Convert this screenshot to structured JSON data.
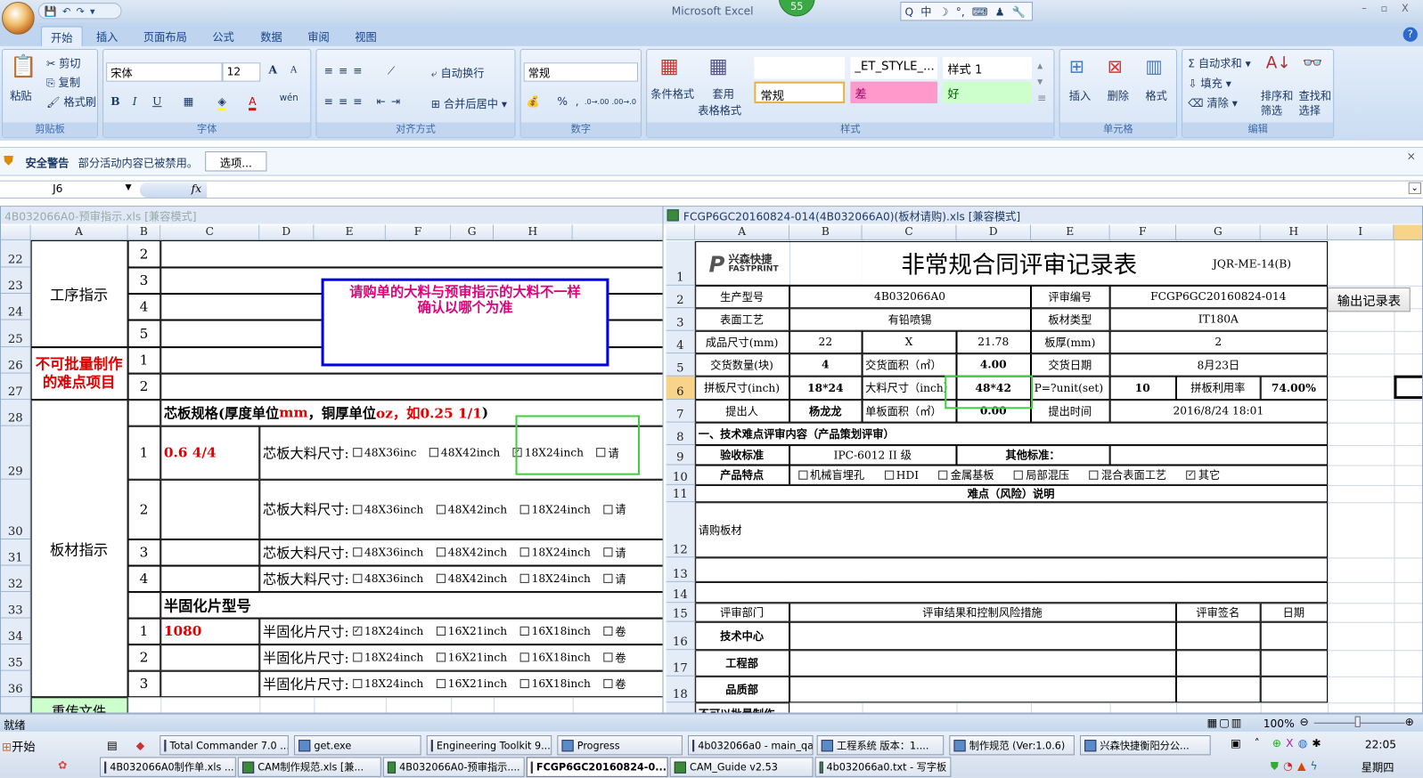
{
  "app": {
    "title": "Microsoft Excel",
    "badge": "55",
    "qat_icons": [
      "save-icon",
      "undo-icon",
      "redo-icon",
      "customize-icon"
    ],
    "ime": [
      "Q",
      "中",
      "☽",
      "°,",
      "⌨",
      "♟",
      "🔧"
    ],
    "window_controls": "– ▫ X",
    "help": "?"
  },
  "tabs": [
    {
      "label": "开始",
      "active": true
    },
    {
      "label": "插入"
    },
    {
      "label": "页面布局"
    },
    {
      "label": "公式"
    },
    {
      "label": "数据"
    },
    {
      "label": "审阅"
    },
    {
      "label": "视图"
    }
  ],
  "ribbon": {
    "clipboard": {
      "label": "剪贴板",
      "paste": "粘贴",
      "cut": "剪切",
      "copy": "复制",
      "format_painter": "格式刷"
    },
    "font": {
      "label": "字体",
      "name": "宋体",
      "size": "12",
      "bold": "B",
      "italic": "I",
      "underline": "U",
      "grow": "A",
      "shrink": "A",
      "font_color": "A",
      "phonetic": "wén"
    },
    "alignment": {
      "label": "对齐方式",
      "wrap": "自动换行",
      "merge": "合并后居中"
    },
    "number": {
      "label": "数字",
      "format": "常规",
      "percent": "%",
      "comma": ",",
      "inc": ".0→.00",
      "dec": ".00→.0"
    },
    "styles": {
      "label": "样式",
      "conditional": "条件格式",
      "table_format_1": "套用",
      "table_format_2": "表格格式",
      "cells": [
        "",
        "_ET_STYLE_...",
        "样式 1",
        "常规",
        "差",
        "好"
      ],
      "colors": {
        "bad": "#ff99cc",
        "good": "#ccffcc"
      }
    },
    "cells": {
      "label": "单元格",
      "insert": "插入",
      "delete": "删除",
      "format": "格式"
    },
    "editing": {
      "label": "编辑",
      "autosum": "自动求和",
      "fill": "填充",
      "clear": "清除",
      "sort_1": "排序和",
      "sort_2": "筛选",
      "find_1": "查找和",
      "find_2": "选择"
    }
  },
  "security": {
    "title": "安全警告",
    "message": "部分活动内容已被禁用。",
    "options_button": "选项..."
  },
  "formula_bar": {
    "name_box": "J6",
    "fx": "fx",
    "value": ""
  },
  "left_sheet": {
    "title": "4B032066A0-预审指示.xls  [兼容模式]",
    "columns": [
      "A",
      "B",
      "C",
      "D",
      "E",
      "F",
      "G",
      "H",
      ""
    ],
    "rows": [
      "22",
      "23",
      "24",
      "25",
      "26",
      "27",
      "28",
      "29",
      "30",
      "31",
      "32",
      "33",
      "34",
      "35",
      "36",
      ""
    ],
    "cells": [
      {
        "ref": "A1:A4",
        "text": "工序指示",
        "size": 16
      },
      {
        "ref": "A5:A6",
        "text": "不可批量制作的难点项目",
        "color": "#e00000",
        "bold": true,
        "size": 16,
        "wrap": true
      },
      {
        "ref": "A7:A15",
        "text": "板材指示",
        "size": 16
      },
      {
        "ref": "A16",
        "text": "重传文件",
        "bg": "#ccffcc",
        "size": 15
      },
      {
        "ref": "B1",
        "text": "2",
        "size": 15
      },
      {
        "ref": "B2",
        "text": "3",
        "size": 15
      },
      {
        "ref": "B3",
        "text": "4",
        "size": 15
      },
      {
        "ref": "B4",
        "text": "5",
        "size": 15
      },
      {
        "ref": "B5",
        "text": "1",
        "size": 15
      },
      {
        "ref": "B6",
        "text": "2",
        "size": 15
      },
      {
        "ref": "B7",
        "text": ""
      },
      {
        "ref": "B8",
        "text": "1",
        "size": 15
      },
      {
        "ref": "B9",
        "text": "2",
        "size": 15
      },
      {
        "ref": "B10",
        "text": "3",
        "size": 15
      },
      {
        "ref": "B11",
        "text": "4",
        "size": 15
      },
      {
        "ref": "B12",
        "text": ""
      },
      {
        "ref": "B13",
        "text": "1",
        "size": 15
      },
      {
        "ref": "B14",
        "text": "2",
        "size": 15
      },
      {
        "ref": "B15",
        "text": "3",
        "size": 15
      },
      {
        "ref": "C1:I1",
        "text": ""
      },
      {
        "ref": "C2:I2",
        "text": ""
      },
      {
        "ref": "C3:I3",
        "text": ""
      },
      {
        "ref": "C4:I4",
        "text": ""
      },
      {
        "ref": "C5:I5",
        "text": ""
      },
      {
        "ref": "C6:I6",
        "text": ""
      },
      {
        "ref": "C7:I7",
        "rich": [
          {
            "t": "芯板规格(厚度单位"
          },
          {
            "t": "mm",
            "c": "#e00000"
          },
          {
            "t": "，铜厚单位"
          },
          {
            "t": "oz，如0.25 1/1",
            "c": "#e00000"
          },
          {
            "t": ")"
          }
        ],
        "bold": true,
        "size": 15,
        "left": true
      },
      {
        "ref": "C8",
        "text": "0.6 4/4",
        "color": "#e00000",
        "bold": true,
        "size": 15,
        "left": true
      },
      {
        "ref": "C9",
        "text": ""
      },
      {
        "ref": "C10",
        "text": ""
      },
      {
        "ref": "C11",
        "text": ""
      },
      {
        "ref": "C12:I12",
        "text": "半固化片型号",
        "bold": true,
        "size": 16,
        "left": true
      },
      {
        "ref": "C13",
        "text": "1080",
        "color": "#e00000",
        "bold": true,
        "size": 15,
        "left": true
      },
      {
        "ref": "C14",
        "text": ""
      },
      {
        "ref": "C15",
        "text": ""
      },
      {
        "ref": "D8:I8",
        "text": "芯板大料尺寸:",
        "size": 15,
        "left": true,
        "options": [
          {
            "label": "48X36inc",
            "checked": false
          },
          {
            "label": "48X42inch",
            "checked": false
          },
          {
            "label": "18X24inch",
            "checked": true
          },
          {
            "label": "请",
            "checked": false
          }
        ]
      },
      {
        "ref": "D9:I9",
        "text": "芯板大料尺寸:",
        "size": 15,
        "left": true,
        "options": [
          {
            "label": "48X36inch",
            "checked": false
          },
          {
            "label": "48X42inch",
            "checked": false
          },
          {
            "label": "18X24inch",
            "checked": false
          },
          {
            "label": "请",
            "checked": false
          }
        ]
      },
      {
        "ref": "D10:I10",
        "text": "芯板大料尺寸:",
        "size": 15,
        "left": true,
        "options": [
          {
            "label": "48X36inch",
            "checked": false
          },
          {
            "label": "48X42inch",
            "checked": false
          },
          {
            "label": "18X24inch",
            "checked": false
          },
          {
            "label": "请",
            "checked": false
          }
        ]
      },
      {
        "ref": "D11:I11",
        "text": "芯板大料尺寸:",
        "size": 15,
        "left": true,
        "options": [
          {
            "label": "48X36inch",
            "checked": false
          },
          {
            "label": "48X42inch",
            "checked": false
          },
          {
            "label": "18X24inch",
            "checked": false
          },
          {
            "label": "请",
            "checked": false
          }
        ]
      },
      {
        "ref": "D13:I13",
        "text": "半固化片尺寸:",
        "size": 15,
        "left": true,
        "options": [
          {
            "label": "18X24inch",
            "checked": true
          },
          {
            "label": "16X21inch",
            "checked": false
          },
          {
            "label": "16X18inch",
            "checked": false
          },
          {
            "label": "卷",
            "checked": false
          }
        ]
      },
      {
        "ref": "D14:I14",
        "text": "半固化片尺寸:",
        "size": 15,
        "left": true,
        "options": [
          {
            "label": "18X24inch",
            "checked": false
          },
          {
            "label": "16X21inch",
            "checked": false
          },
          {
            "label": "16X18inch",
            "checked": false
          },
          {
            "label": "卷",
            "checked": false
          }
        ]
      },
      {
        "ref": "D15:I15",
        "text": "半固化片尺寸:",
        "size": 15,
        "left": true,
        "options": [
          {
            "label": "18X24inch",
            "checked": false
          },
          {
            "label": "16X21inch",
            "checked": false
          },
          {
            "label": "16X18inch",
            "checked": false
          },
          {
            "label": "卷",
            "checked": false
          }
        ]
      }
    ],
    "textbox": {
      "line1": "请购单的大料与预审指示的大料不一样",
      "line2": "确认以哪个为准",
      "color": "#e0007a",
      "border": "#0000e0"
    }
  },
  "right_sheet": {
    "title": "FCGP6GC20160824-014(4B032066A0)(板材请购).xls  [兼容模式]",
    "columns": [
      "A",
      "B",
      "C",
      "D",
      "E",
      "F",
      "G",
      "H",
      "I",
      ""
    ],
    "rows": [
      "1",
      "2",
      "3",
      "4",
      "5",
      "6",
      "7",
      "8",
      "9",
      "10",
      "11",
      "12",
      "13",
      "14",
      "15",
      "16",
      "17",
      "18",
      "19"
    ],
    "selected_cell": "J6",
    "logo": {
      "cn": "兴森快捷",
      "en": "FASTPRINT"
    },
    "output_button": "输出记录表",
    "cells": [
      {
        "ref": "C1:F1",
        "text": "非常规合同评审记录表",
        "size": 26,
        "nob": true
      },
      {
        "ref": "G1:H1",
        "text": "JQR-ME-14(B)",
        "size": 12,
        "nob": true
      },
      {
        "ref": "A2",
        "text": "生产型号"
      },
      {
        "ref": "B2:D2",
        "text": "4B032066A0"
      },
      {
        "ref": "E2",
        "text": "评审编号"
      },
      {
        "ref": "F2:H2",
        "text": "FCGP6GC20160824-014"
      },
      {
        "ref": "A3",
        "text": "表面工艺"
      },
      {
        "ref": "B3:D3",
        "text": "有铅喷锡"
      },
      {
        "ref": "E3",
        "text": "板材类型"
      },
      {
        "ref": "F3:H3",
        "text": "IT180A"
      },
      {
        "ref": "A4",
        "text": "成品尺寸(mm)"
      },
      {
        "ref": "B4",
        "text": "22"
      },
      {
        "ref": "C4",
        "text": "X"
      },
      {
        "ref": "D4",
        "text": "21.78"
      },
      {
        "ref": "E4",
        "text": "板厚(mm)"
      },
      {
        "ref": "F4:H4",
        "text": "2"
      },
      {
        "ref": "A5",
        "text": "交货数量(块)"
      },
      {
        "ref": "B5",
        "text": "4",
        "bold": true
      },
      {
        "ref": "C5",
        "text": "交货面积（㎡）",
        "left": true
      },
      {
        "ref": "D5",
        "text": "4.00",
        "bold": true
      },
      {
        "ref": "E5",
        "text": "交货日期"
      },
      {
        "ref": "F5:H5",
        "text": "8月23日"
      },
      {
        "ref": "A6",
        "text": "拼板尺寸(inch)"
      },
      {
        "ref": "B6",
        "text": "18*24",
        "bold": true
      },
      {
        "ref": "C6",
        "text": "大料尺寸（inch）",
        "left": true
      },
      {
        "ref": "D6",
        "text": "48*42",
        "bold": true
      },
      {
        "ref": "E6",
        "text": "P=?unit(set)",
        "left": true
      },
      {
        "ref": "F6",
        "text": "10",
        "bold": true
      },
      {
        "ref": "G6",
        "text": "拼板利用率"
      },
      {
        "ref": "H6",
        "text": "74.00%",
        "bold": true
      },
      {
        "ref": "A7",
        "text": "提出人"
      },
      {
        "ref": "B7",
        "text": "杨龙龙",
        "bold": true
      },
      {
        "ref": "C7",
        "text": "单板面积（㎡）",
        "left": true
      },
      {
        "ref": "D7",
        "text": "0.00",
        "bold": true
      },
      {
        "ref": "E7",
        "text": "提出时间"
      },
      {
        "ref": "F7:H7",
        "text": "2016/8/24 18:01"
      },
      {
        "ref": "A8:H8",
        "text": "一、技术难点评审内容（产品策划评审）",
        "bold": true,
        "left": true
      },
      {
        "ref": "A9",
        "text": "验收标准",
        "bold": true
      },
      {
        "ref": "B9:C9",
        "text": "IPC-6012 II 级"
      },
      {
        "ref": "D9:E9",
        "text": "其他标准：",
        "bold": true
      },
      {
        "ref": "F9:H9",
        "text": ""
      },
      {
        "ref": "A10",
        "text": "产品特点",
        "bold": true
      },
      {
        "ref": "B10:H10",
        "text": "",
        "left": true,
        "options": [
          {
            "label": "机械盲埋孔",
            "checked": false
          },
          {
            "label": "HDI",
            "checked": false
          },
          {
            "label": "金属基板",
            "checked": false
          },
          {
            "label": "局部混压",
            "checked": false
          },
          {
            "label": "混合表面工艺",
            "checked": false
          },
          {
            "label": "其它",
            "checked": true
          }
        ]
      },
      {
        "ref": "A11:H11",
        "text": "难点（风险）说明",
        "bold": true
      },
      {
        "ref": "A12:H12",
        "text": "请购板材",
        "left": true
      },
      {
        "ref": "A13:H13",
        "text": ""
      },
      {
        "ref": "A14:H14",
        "text": ""
      },
      {
        "ref": "A15",
        "text": "评审部门"
      },
      {
        "ref": "B15:F15",
        "text": "评审结果和控制风险措施"
      },
      {
        "ref": "G15",
        "text": "评审签名"
      },
      {
        "ref": "H15",
        "text": "日期"
      },
      {
        "ref": "A16",
        "text": "技术中心",
        "bold": true
      },
      {
        "ref": "B16:F16",
        "text": ""
      },
      {
        "ref": "G16",
        "text": ""
      },
      {
        "ref": "H16",
        "text": ""
      },
      {
        "ref": "A17",
        "text": "工程部",
        "bold": true
      },
      {
        "ref": "B17:F17",
        "text": ""
      },
      {
        "ref": "G17",
        "text": ""
      },
      {
        "ref": "H17",
        "text": ""
      },
      {
        "ref": "A18",
        "text": "品质部",
        "bold": true
      },
      {
        "ref": "B18:F18",
        "text": ""
      },
      {
        "ref": "G18",
        "text": ""
      },
      {
        "ref": "H18",
        "text": ""
      },
      {
        "ref": "A19",
        "text": "不可以批量制作",
        "bold": true,
        "left": true
      }
    ]
  },
  "status_bar": {
    "ready": "就绪",
    "zoom": "100%"
  },
  "taskbar": {
    "start": "开始",
    "row1": [
      {
        "label": "Total Commander 7.0 ..."
      },
      {
        "label": "get.exe"
      },
      {
        "label": "Engineering Toolkit 9...."
      },
      {
        "label": "Progress"
      },
      {
        "label": "4b032066a0 - main_qa"
      },
      {
        "label": "工程系统  版本：1...."
      },
      {
        "label": "制作规范 (Ver:1.0.6)"
      },
      {
        "label": "兴森快捷衡阳分公..."
      }
    ],
    "row2": [
      {
        "label": "4B032066A0制作单.xls ..."
      },
      {
        "label": "CAM制作规范.xls [兼..."
      },
      {
        "label": "4B032066A0-预审指示...."
      },
      {
        "label": "FCGP6GC20160824-0...",
        "active": true
      },
      {
        "label": "CAM_Guide v2.53"
      },
      {
        "label": "4b032066a0.txt - 写字板"
      }
    ],
    "clock": "22:05",
    "day": "星期四"
  }
}
